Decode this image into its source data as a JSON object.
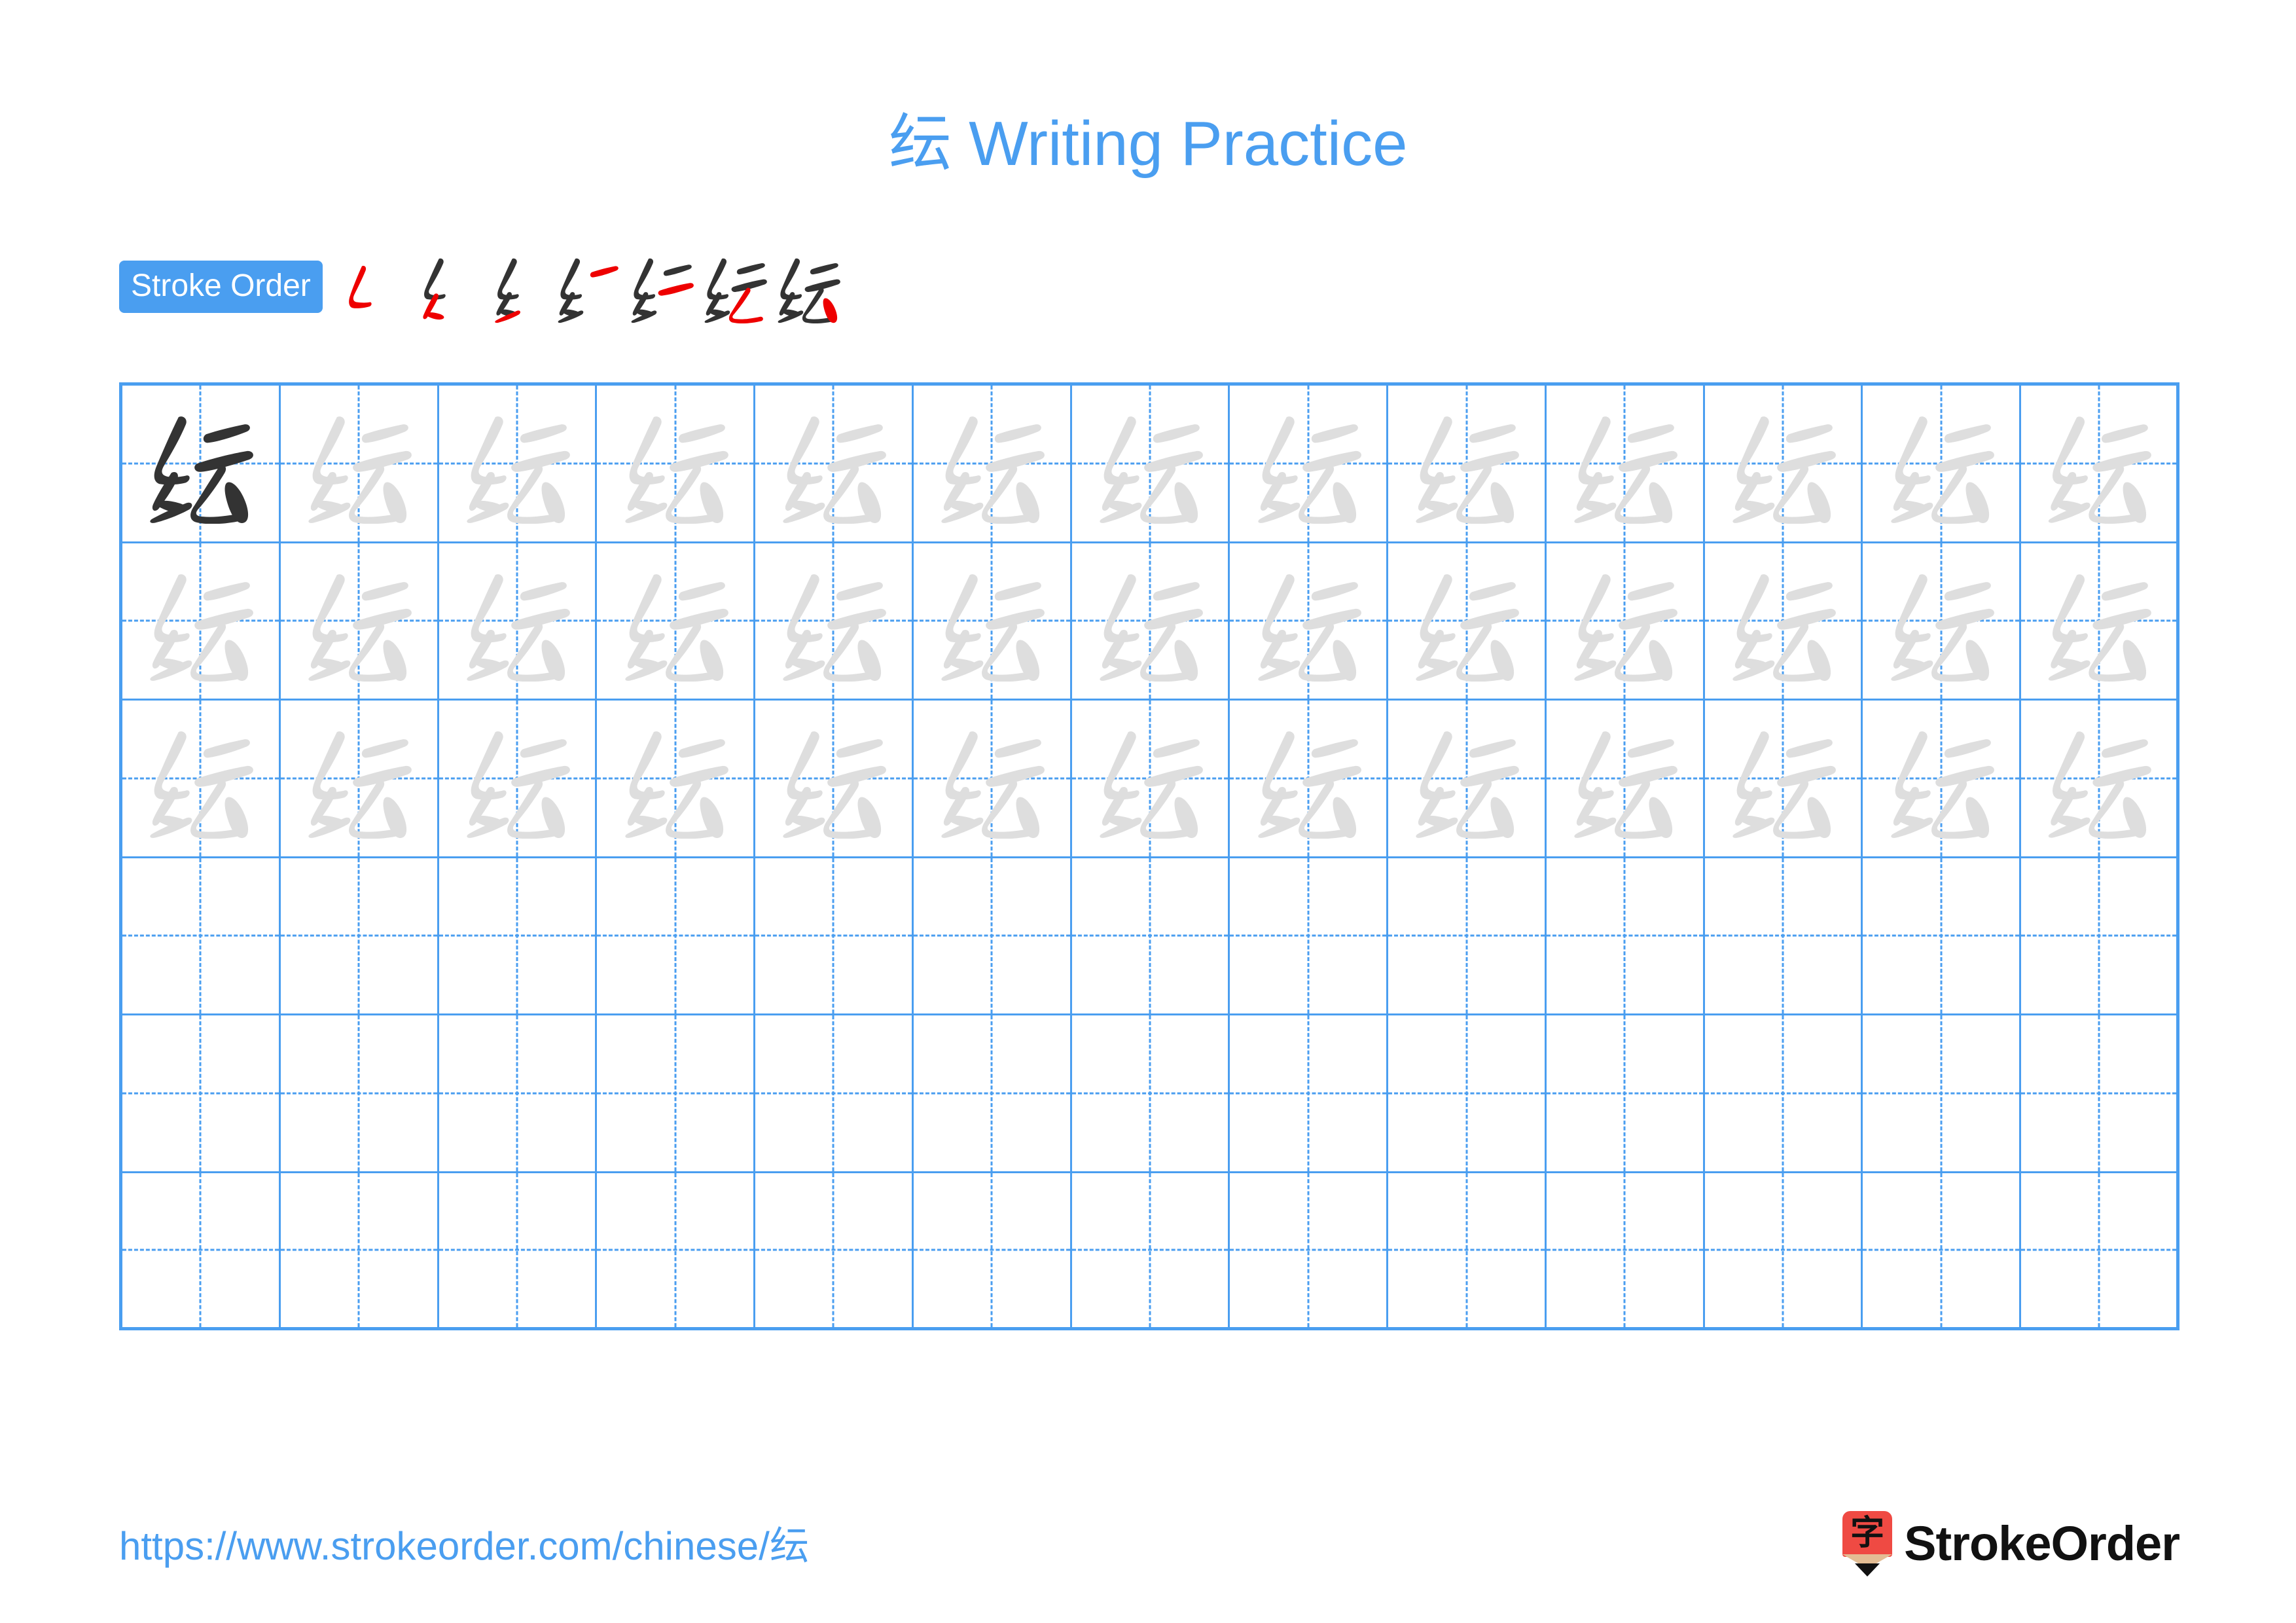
{
  "character": "纭",
  "title": {
    "character": "纭",
    "suffix": " Writing Practice",
    "full": "纭 Writing Practice",
    "color": "#4a9ef0"
  },
  "stroke_order": {
    "badge_label": "Stroke Order",
    "badge_bg": "#4a9ef0",
    "badge_text_color": "#ffffff",
    "stroke_count": 7,
    "new_stroke_color": "#ee0000",
    "existing_stroke_color": "#333333",
    "steps": [
      {
        "index": 1,
        "name": "pie-zhe",
        "strokes_shown": 1
      },
      {
        "index": 2,
        "name": "pie-zhe-2",
        "strokes_shown": 2
      },
      {
        "index": 3,
        "name": "ti",
        "strokes_shown": 3
      },
      {
        "index": 4,
        "name": "heng-top",
        "strokes_shown": 4
      },
      {
        "index": 5,
        "name": "heng-second",
        "strokes_shown": 5
      },
      {
        "index": 6,
        "name": "pie-zhe-yun",
        "strokes_shown": 6
      },
      {
        "index": 7,
        "name": "dian",
        "strokes_shown": 7
      }
    ]
  },
  "grid": {
    "columns": 13,
    "rows": 6,
    "line_color": "#4a9ef0",
    "dark_glyph_color": "#333333",
    "faint_glyph_color": "#dedede",
    "traced_rows": 3,
    "blank_rows": 3,
    "first_cell_is_dark": true
  },
  "footer": {
    "url": "https://www.strokeorder.com/chinese/纭",
    "url_color": "#4a9ef0",
    "brand_name": "StrokeOrder",
    "brand_icon_character": "字",
    "brand_icon_color": "#ef4a43",
    "brand_icon_wood_color": "#e3bd94",
    "brand_icon_tip_color": "#111111",
    "brand_text_color": "#111111"
  }
}
